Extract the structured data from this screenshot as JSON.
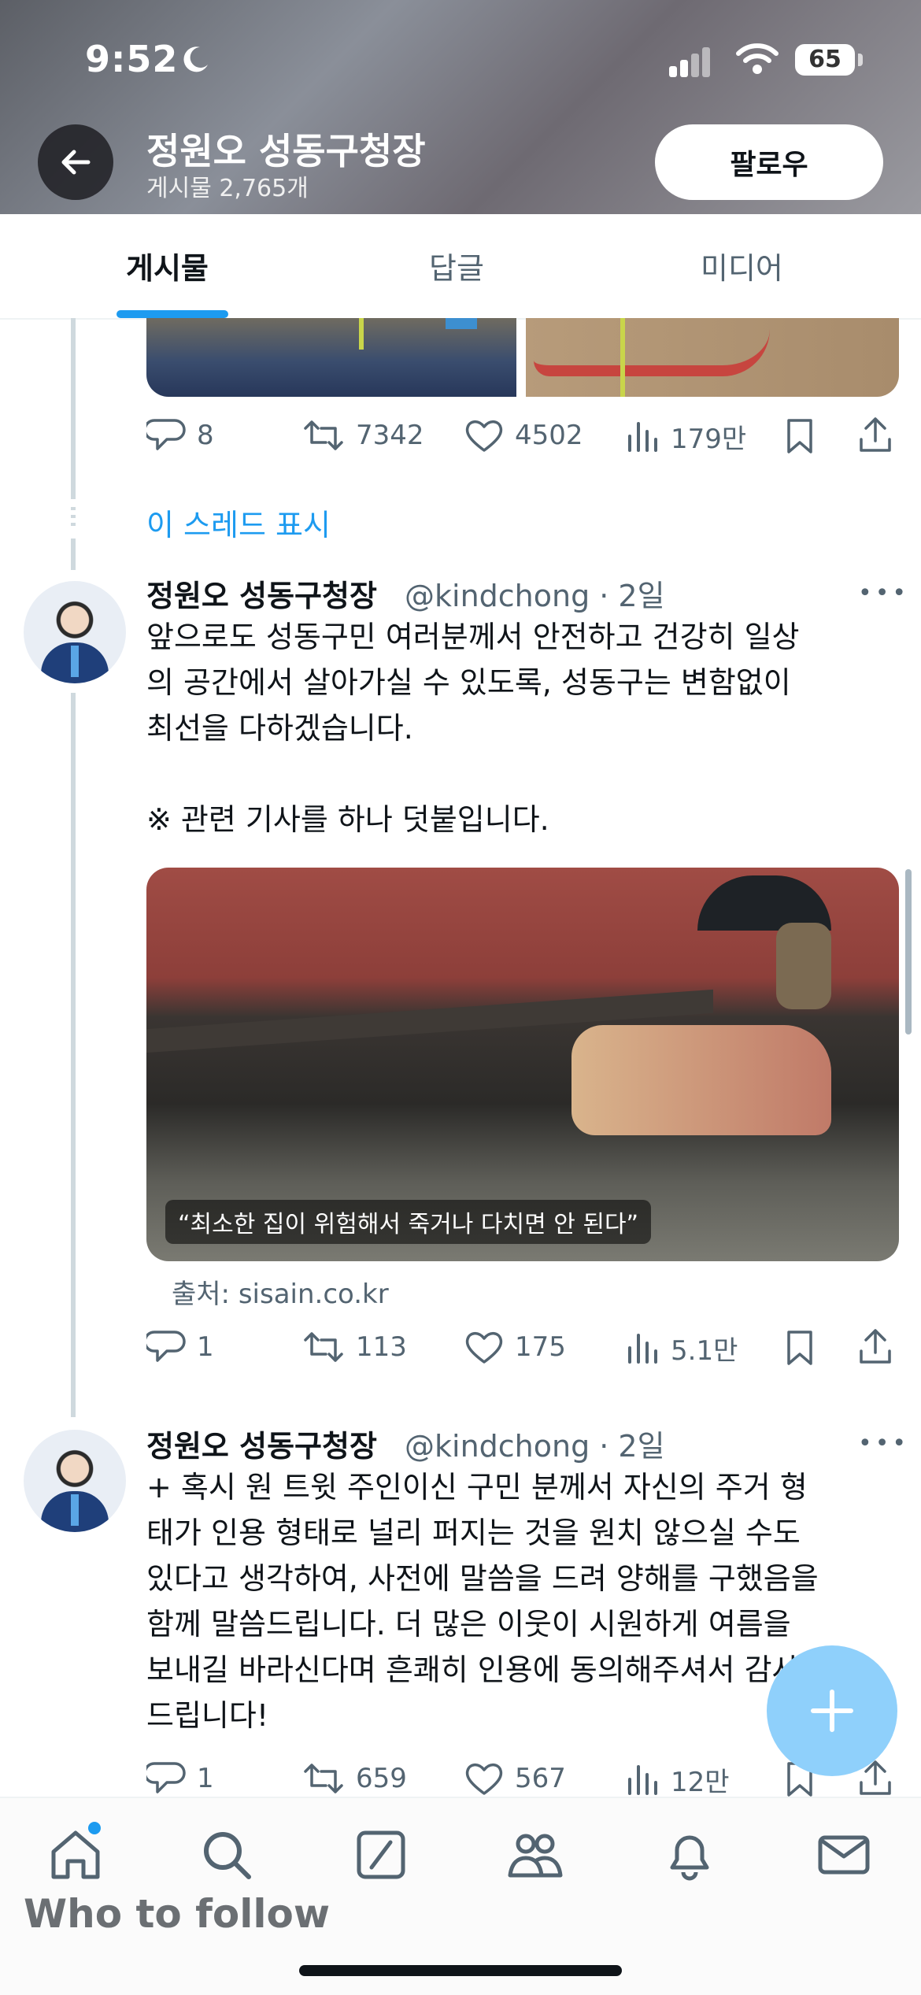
{
  "status_bar": {
    "time": "9:52",
    "battery": "65"
  },
  "header": {
    "title": "정원오 성동구청장",
    "subtitle": "게시물 2,765개",
    "follow_label": "팔로우"
  },
  "tabs": [
    {
      "label": "게시물",
      "active": true
    },
    {
      "label": "답글",
      "active": false
    },
    {
      "label": "미디어",
      "active": false
    }
  ],
  "posts": [
    {
      "actions": {
        "replies": "8",
        "reposts": "7342",
        "likes": "4502",
        "views": "179만"
      }
    },
    {
      "show_thread": "이 스레드 표시"
    },
    {
      "name": "정원오 성동구청장",
      "handle": "@kindchong · 2일",
      "text": "앞으로도 성동구민 여러분께서 안전하고 건강히 일상\n의 공간에서 살아가실 수 있도록, 성동구는 변함없이\n최선을 다하겠습니다.\n\n※ 관련 기사를 하나 덧붙입니다.",
      "card_caption": "“최소한 집이 위험해서 죽거나 다치면 안 된다”",
      "card_source": "출처: sisain.co.kr",
      "actions": {
        "replies": "1",
        "reposts": "113",
        "likes": "175",
        "views": "5.1만"
      }
    },
    {
      "name": "정원오 성동구청장",
      "handle": "@kindchong · 2일",
      "text": "+ 혹시 원 트윗 주인이신 구민 분께서 자신의 주거 형\n태가 인용 형태로 널리 퍼지는 것을 원치 않으실 수도\n있다고 생각하여, 사전에 말씀을 드려 양해를 구했음을\n함께 말씀드립니다. 더 많은 이웃이 시원하게 여름을\n보내길 바라신다며 흔쾌히 인용에 동의해주셔서 감사\n드립니다!",
      "actions": {
        "replies": "1",
        "reposts": "659",
        "likes": "567",
        "views": "12만"
      }
    }
  ],
  "bottom_nav": {
    "items": [
      "home-icon",
      "search-icon",
      "grok-icon",
      "communities-icon",
      "notifications-icon",
      "messages-icon"
    ],
    "who_to_follow": "Who to follow"
  },
  "colors": {
    "accent": "#1d9bf0",
    "text": "#0f1419",
    "muted": "#536471"
  }
}
